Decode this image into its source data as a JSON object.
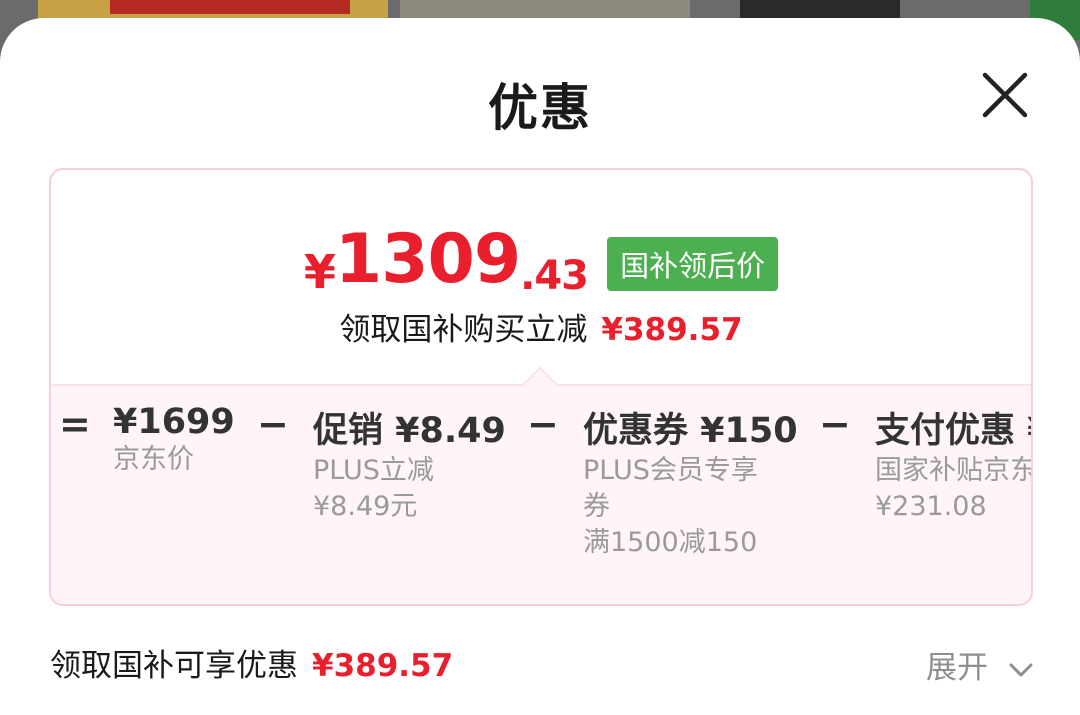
{
  "sheet": {
    "title": "优惠",
    "close_icon": "close-icon"
  },
  "summary": {
    "price_symbol": "¥",
    "price_integer": "1309",
    "price_decimal": ".43",
    "price_badge": "国补领后价",
    "saving_label": "领取国补购买立减",
    "saving_amount": "¥389.57"
  },
  "breakdown": {
    "ops": [
      "=",
      "−",
      "−",
      "−"
    ],
    "items": [
      {
        "value": "¥1699",
        "lines": [
          "京东价"
        ]
      },
      {
        "value": "促销 ¥8.49",
        "lines": [
          "PLUS立减",
          "¥8.49元"
        ]
      },
      {
        "value": "优惠券 ¥150",
        "lines": [
          "PLUS会员专享",
          "券",
          "满1500减150"
        ]
      },
      {
        "value": "支付优惠 ¥",
        "lines": [
          "国家补贴京东",
          "¥231.08"
        ]
      }
    ]
  },
  "footer": {
    "label": "领取国补可享优惠",
    "amount": "¥389.57",
    "expand_label": "展开",
    "expand_icon": "chevron-down-icon"
  },
  "colors": {
    "accent_red": "#ea1f2e",
    "badge_green": "#4caf50",
    "card_border": "#f7cdd8",
    "breakdown_bg": "#fff4f7"
  }
}
